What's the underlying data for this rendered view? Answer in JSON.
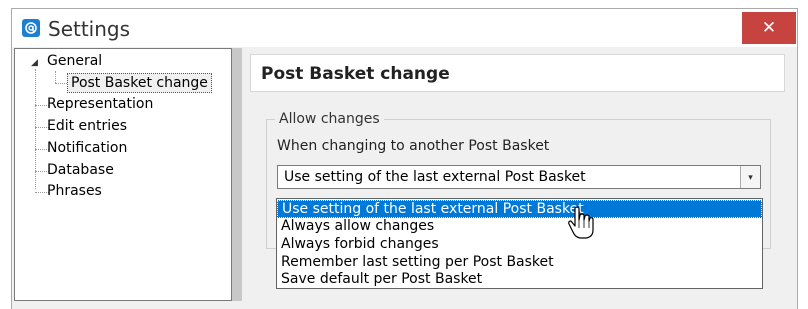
{
  "window": {
    "title": "Settings",
    "close_glyph": "✕",
    "app_icon": "at-sign-icon"
  },
  "tree": {
    "items": [
      {
        "label": "General",
        "expanded": true
      },
      {
        "label": "Post Basket change",
        "selected": true
      },
      {
        "label": "Representation"
      },
      {
        "label": "Edit entries"
      },
      {
        "label": "Notification"
      },
      {
        "label": "Database"
      },
      {
        "label": "Phrases"
      }
    ],
    "expander_glyph": "◢"
  },
  "main": {
    "title": "Post Basket change",
    "group": {
      "legend": "Allow changes",
      "label": "When changing to another Post Basket",
      "select_value": "Use setting of the last external Post Basket",
      "arrow_glyph": "▾"
    }
  },
  "dropdown": {
    "options": [
      "Use setting of the last external Post Basket",
      "Always allow changes",
      "Always forbid changes",
      "Remember last setting per Post Basket",
      "Save default per Post Basket"
    ],
    "highlighted_index": 0
  },
  "colors": {
    "close_button": "#c7433f",
    "selection": "#0078d7",
    "app_icon": "#1e7fd0"
  }
}
